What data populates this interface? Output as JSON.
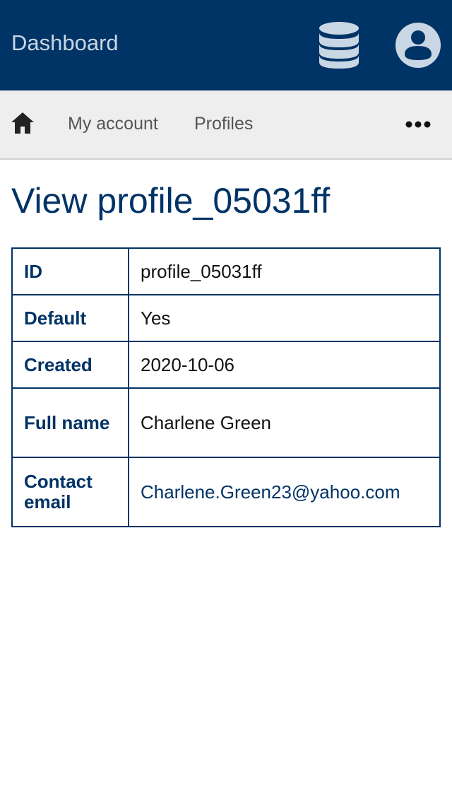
{
  "header": {
    "brand": "Dashboard",
    "db_icon": "database-icon",
    "user_icon": "user-circle-icon",
    "bg_color": "#003366"
  },
  "nav": {
    "home_icon": "home-icon",
    "items": [
      {
        "label": "My account"
      },
      {
        "label": "Profiles"
      }
    ],
    "more_icon": "more-horizontal-icon"
  },
  "main": {
    "title": "View profile_05031ff",
    "rows": [
      {
        "label": "ID",
        "value": "profile_05031ff"
      },
      {
        "label": "Default",
        "value": "Yes"
      },
      {
        "label": "Created",
        "value": "2020-10-06"
      },
      {
        "label": "Full name",
        "value": "Charlene Green"
      },
      {
        "label": "Contact email",
        "value": "Charlene.Green23@yahoo.com"
      }
    ]
  }
}
